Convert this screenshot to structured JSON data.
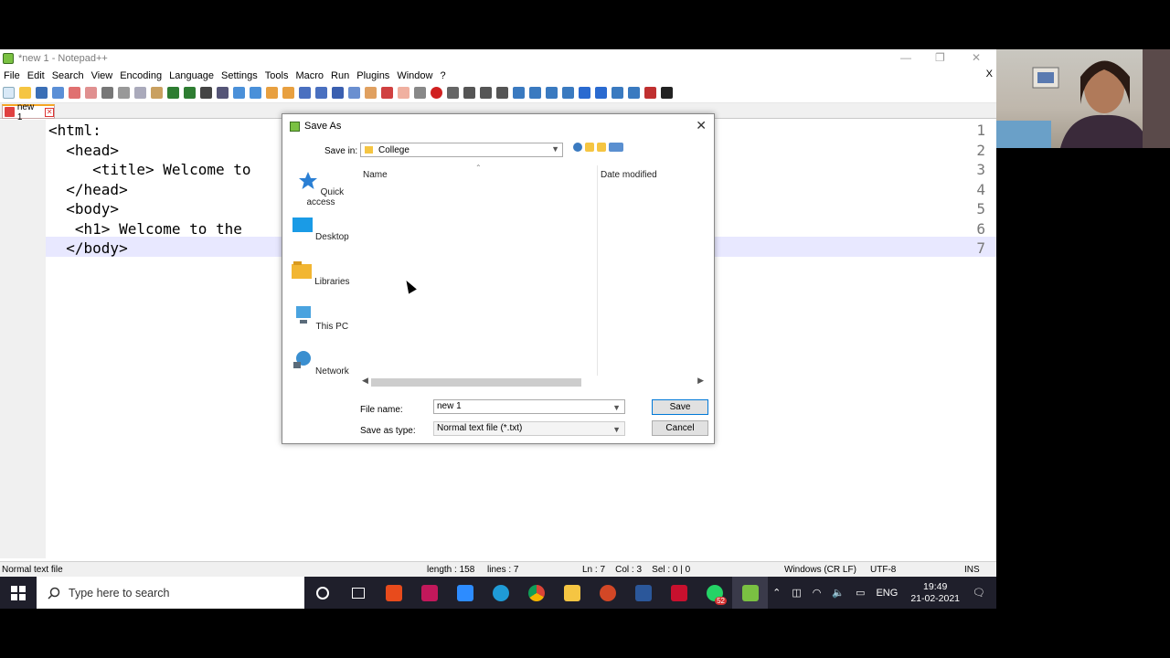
{
  "window": {
    "title": "*new 1 - Notepad++"
  },
  "menu": [
    "File",
    "Edit",
    "Search",
    "View",
    "Encoding",
    "Language",
    "Settings",
    "Tools",
    "Macro",
    "Run",
    "Plugins",
    "Window",
    "?"
  ],
  "menu_close": "X",
  "tab": {
    "label": "new 1"
  },
  "editor": {
    "lines": [
      {
        "num": "1",
        "text": "<html:"
      },
      {
        "num": "2",
        "text": "  <head>"
      },
      {
        "num": "3",
        "text": "     <title> Welcome to"
      },
      {
        "num": "4",
        "text": "  </head>"
      },
      {
        "num": "5",
        "text": "  <body>"
      },
      {
        "num": "6",
        "text": "   <h1> Welcome to the"
      },
      {
        "num": "7",
        "text": "  </body>"
      }
    ]
  },
  "status": {
    "type": "Normal text file",
    "length": "length : 158",
    "lines": "lines : 7",
    "pos": "Ln : 7    Col : 3    Sel : 0 | 0",
    "eol": "Windows (CR LF)",
    "encoding": "UTF-8",
    "mode": "INS"
  },
  "dialog": {
    "title": "Save As",
    "save_in_label": "Save in:",
    "save_in_value": "College",
    "places": [
      {
        "label": "Quick access",
        "icon": "star-icon",
        "color": "#2a7fd4"
      },
      {
        "label": "Desktop",
        "icon": "desktop-icon",
        "color": "#1a9be6"
      },
      {
        "label": "Libraries",
        "icon": "folder-icon",
        "color": "#f2b632"
      },
      {
        "label": "This PC",
        "icon": "computer-icon",
        "color": "#4aa3df"
      },
      {
        "label": "Network",
        "icon": "network-icon",
        "color": "#3a8fd0"
      }
    ],
    "col_name": "Name",
    "col_date": "Date modified",
    "file_name_label": "File name:",
    "file_name_value": "new 1",
    "save_type_label": "Save as type:",
    "save_type_value": "Normal text file (*.txt)",
    "save_label": "Save",
    "cancel_label": "Cancel"
  },
  "taskbar": {
    "search_placeholder": "Type here to search",
    "whatsapp_badge": "52",
    "lang": "ENG",
    "time": "19:49",
    "date": "21-02-2021"
  }
}
